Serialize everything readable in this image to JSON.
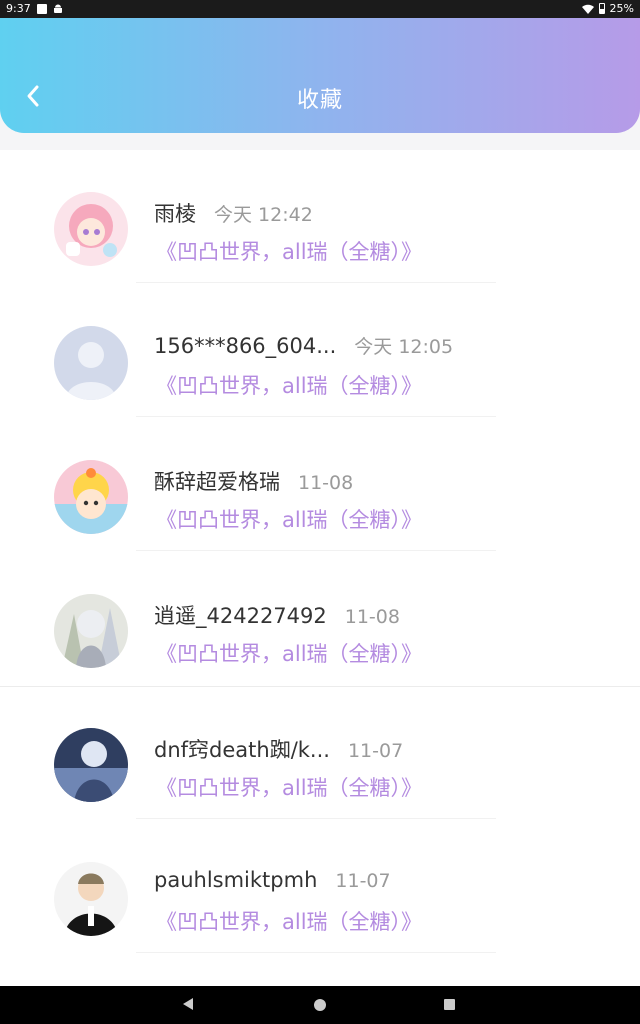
{
  "status_bar": {
    "time": "9:37",
    "battery": "25%"
  },
  "header": {
    "title": "收藏"
  },
  "list": [
    {
      "name": "雨棱",
      "time": "今天 12:42",
      "content": "《凹凸世界，all瑞（全糖）》"
    },
    {
      "name": "156***866_604...",
      "time": "今天 12:05",
      "content": "《凹凸世界，all瑞（全糖）》"
    },
    {
      "name": "酥辞超爱格瑞",
      "time": "11-08",
      "content": "《凹凸世界，all瑞（全糖）》"
    },
    {
      "name": "逍遥_424227492",
      "time": "11-08",
      "content": "《凹凸世界，all瑞（全糖）》"
    },
    {
      "name": "dnf窍death踟/k...",
      "time": "11-07",
      "content": "《凹凸世界，all瑞（全糖）》"
    },
    {
      "name": "pauhlsmiktpmh",
      "time": "11-07",
      "content": "《凹凸世界，all瑞（全糖）》"
    }
  ],
  "colors": {
    "accent": "#b48be0",
    "header_start": "#5fd0f0",
    "header_end": "#b69be8"
  }
}
